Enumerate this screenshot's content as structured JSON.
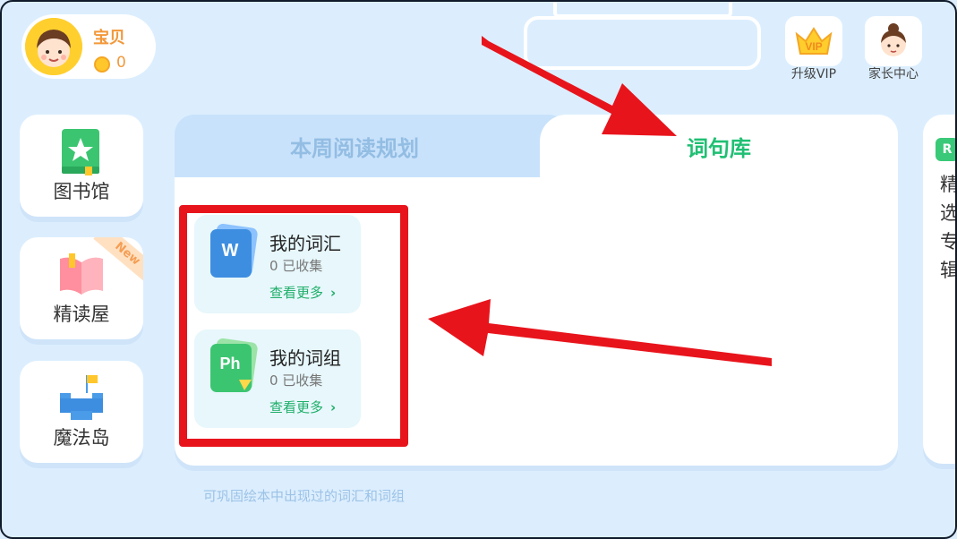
{
  "profile": {
    "name": "宝贝",
    "coins": "0"
  },
  "top_buttons": [
    {
      "label": "升级VIP",
      "icon": "vip-crown-icon"
    },
    {
      "label": "家长中心",
      "icon": "parent-avatar-icon"
    }
  ],
  "nav": [
    {
      "label": "图书馆",
      "icon": "book-star-icon"
    },
    {
      "label": "精读屋",
      "icon": "open-book-icon",
      "badge": "New"
    },
    {
      "label": "魔法岛",
      "icon": "castle-flag-icon"
    }
  ],
  "tabs": [
    {
      "label": "本周阅读规划",
      "active": false
    },
    {
      "label": "词句库",
      "active": true
    }
  ],
  "vocab_cards": [
    {
      "title": "我的词汇",
      "count": "0 已收集",
      "link": "查看更多",
      "icon_letter": "W"
    },
    {
      "title": "我的词组",
      "count": "0 已收集",
      "link": "查看更多",
      "icon_letter": "Ph"
    }
  ],
  "hint": "可巩固绘本中出现过的词汇和词组",
  "side_peek": {
    "badge": "R",
    "text": "精选专辑"
  },
  "colors": {
    "background": "#dceefe",
    "active_tab_text": "#1fbf73",
    "inactive_tab_text": "#93bde3",
    "annotation_red": "#e8141c",
    "coin": "#ffc72b"
  }
}
